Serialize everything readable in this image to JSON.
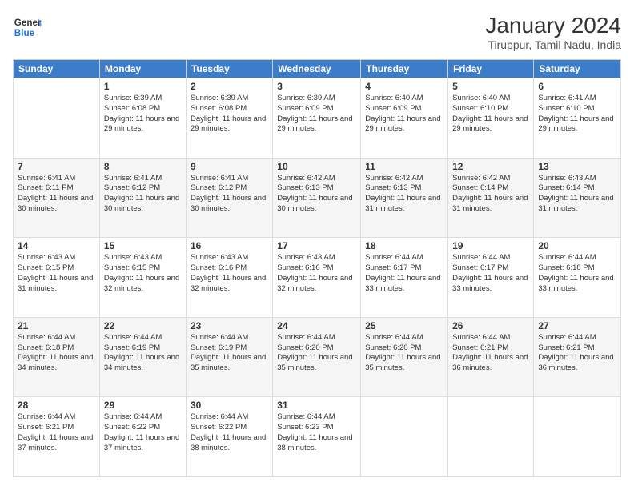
{
  "header": {
    "logo_line1": "General",
    "logo_line2": "Blue",
    "month": "January 2024",
    "location": "Tiruppur, Tamil Nadu, India"
  },
  "days_of_week": [
    "Sunday",
    "Monday",
    "Tuesday",
    "Wednesday",
    "Thursday",
    "Friday",
    "Saturday"
  ],
  "weeks": [
    [
      {
        "day": "",
        "empty": true
      },
      {
        "day": "1",
        "sunrise": "6:39 AM",
        "sunset": "6:08 PM",
        "daylight": "11 hours and 29 minutes."
      },
      {
        "day": "2",
        "sunrise": "6:39 AM",
        "sunset": "6:08 PM",
        "daylight": "11 hours and 29 minutes."
      },
      {
        "day": "3",
        "sunrise": "6:39 AM",
        "sunset": "6:09 PM",
        "daylight": "11 hours and 29 minutes."
      },
      {
        "day": "4",
        "sunrise": "6:40 AM",
        "sunset": "6:09 PM",
        "daylight": "11 hours and 29 minutes."
      },
      {
        "day": "5",
        "sunrise": "6:40 AM",
        "sunset": "6:10 PM",
        "daylight": "11 hours and 29 minutes."
      },
      {
        "day": "6",
        "sunrise": "6:41 AM",
        "sunset": "6:10 PM",
        "daylight": "11 hours and 29 minutes."
      }
    ],
    [
      {
        "day": "7",
        "sunrise": "6:41 AM",
        "sunset": "6:11 PM",
        "daylight": "11 hours and 30 minutes."
      },
      {
        "day": "8",
        "sunrise": "6:41 AM",
        "sunset": "6:12 PM",
        "daylight": "11 hours and 30 minutes."
      },
      {
        "day": "9",
        "sunrise": "6:41 AM",
        "sunset": "6:12 PM",
        "daylight": "11 hours and 30 minutes."
      },
      {
        "day": "10",
        "sunrise": "6:42 AM",
        "sunset": "6:13 PM",
        "daylight": "11 hours and 30 minutes."
      },
      {
        "day": "11",
        "sunrise": "6:42 AM",
        "sunset": "6:13 PM",
        "daylight": "11 hours and 31 minutes."
      },
      {
        "day": "12",
        "sunrise": "6:42 AM",
        "sunset": "6:14 PM",
        "daylight": "11 hours and 31 minutes."
      },
      {
        "day": "13",
        "sunrise": "6:43 AM",
        "sunset": "6:14 PM",
        "daylight": "11 hours and 31 minutes."
      }
    ],
    [
      {
        "day": "14",
        "sunrise": "6:43 AM",
        "sunset": "6:15 PM",
        "daylight": "11 hours and 31 minutes."
      },
      {
        "day": "15",
        "sunrise": "6:43 AM",
        "sunset": "6:15 PM",
        "daylight": "11 hours and 32 minutes."
      },
      {
        "day": "16",
        "sunrise": "6:43 AM",
        "sunset": "6:16 PM",
        "daylight": "11 hours and 32 minutes."
      },
      {
        "day": "17",
        "sunrise": "6:43 AM",
        "sunset": "6:16 PM",
        "daylight": "11 hours and 32 minutes."
      },
      {
        "day": "18",
        "sunrise": "6:44 AM",
        "sunset": "6:17 PM",
        "daylight": "11 hours and 33 minutes."
      },
      {
        "day": "19",
        "sunrise": "6:44 AM",
        "sunset": "6:17 PM",
        "daylight": "11 hours and 33 minutes."
      },
      {
        "day": "20",
        "sunrise": "6:44 AM",
        "sunset": "6:18 PM",
        "daylight": "11 hours and 33 minutes."
      }
    ],
    [
      {
        "day": "21",
        "sunrise": "6:44 AM",
        "sunset": "6:18 PM",
        "daylight": "11 hours and 34 minutes."
      },
      {
        "day": "22",
        "sunrise": "6:44 AM",
        "sunset": "6:19 PM",
        "daylight": "11 hours and 34 minutes."
      },
      {
        "day": "23",
        "sunrise": "6:44 AM",
        "sunset": "6:19 PM",
        "daylight": "11 hours and 35 minutes."
      },
      {
        "day": "24",
        "sunrise": "6:44 AM",
        "sunset": "6:20 PM",
        "daylight": "11 hours and 35 minutes."
      },
      {
        "day": "25",
        "sunrise": "6:44 AM",
        "sunset": "6:20 PM",
        "daylight": "11 hours and 35 minutes."
      },
      {
        "day": "26",
        "sunrise": "6:44 AM",
        "sunset": "6:21 PM",
        "daylight": "11 hours and 36 minutes."
      },
      {
        "day": "27",
        "sunrise": "6:44 AM",
        "sunset": "6:21 PM",
        "daylight": "11 hours and 36 minutes."
      }
    ],
    [
      {
        "day": "28",
        "sunrise": "6:44 AM",
        "sunset": "6:21 PM",
        "daylight": "11 hours and 37 minutes."
      },
      {
        "day": "29",
        "sunrise": "6:44 AM",
        "sunset": "6:22 PM",
        "daylight": "11 hours and 37 minutes."
      },
      {
        "day": "30",
        "sunrise": "6:44 AM",
        "sunset": "6:22 PM",
        "daylight": "11 hours and 38 minutes."
      },
      {
        "day": "31",
        "sunrise": "6:44 AM",
        "sunset": "6:23 PM",
        "daylight": "11 hours and 38 minutes."
      },
      {
        "day": "",
        "empty": true
      },
      {
        "day": "",
        "empty": true
      },
      {
        "day": "",
        "empty": true
      }
    ]
  ]
}
